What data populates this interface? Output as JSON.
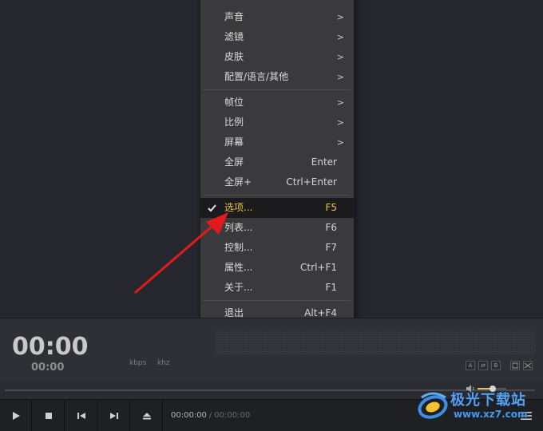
{
  "menu": {
    "items_top": [
      {
        "label": "声音",
        "arrow": ">"
      },
      {
        "label": "滤镜",
        "arrow": ">"
      },
      {
        "label": "皮肤",
        "arrow": ">"
      },
      {
        "label": "配置/语言/其他",
        "arrow": ">"
      }
    ],
    "items_middle": [
      {
        "label": "帧位",
        "arrow": ">"
      },
      {
        "label": "比例",
        "arrow": ">"
      },
      {
        "label": "屏幕",
        "arrow": ">"
      },
      {
        "label": "全屏",
        "shortcut": "Enter"
      },
      {
        "label": "全屏+",
        "shortcut": "Ctrl+Enter"
      }
    ],
    "items_bottom": [
      {
        "label": "选项...",
        "shortcut": "F5",
        "checked": true,
        "highlighted": true
      },
      {
        "label": "列表...",
        "shortcut": "F6"
      },
      {
        "label": "控制...",
        "shortcut": "F7"
      },
      {
        "label": "属性...",
        "shortcut": "Ctrl+F1"
      },
      {
        "label": "关于...",
        "shortcut": "F1"
      }
    ],
    "exit": {
      "label": "退出",
      "shortcut": "Alt+F4"
    },
    "highlight_color": "#e8c53a"
  },
  "info": {
    "time_big": "00:00",
    "time_small": "00:00",
    "kbps": "kbps",
    "khz": "khz",
    "mini_buttons": [
      "A",
      "⇄",
      "B"
    ]
  },
  "controls": {
    "current_time": "00:00:00",
    "separator": "/",
    "total_time": "00:00:00",
    "icons": [
      "play-icon",
      "stop-icon",
      "previous-icon",
      "next-icon",
      "eject-icon",
      "menu-icon",
      "volume-icon"
    ]
  },
  "watermark": {
    "title": "极光下载站",
    "url": "www.xz7.com"
  },
  "colors": {
    "annotation_arrow": "#e01b1b",
    "accent": "#e2c35a"
  }
}
